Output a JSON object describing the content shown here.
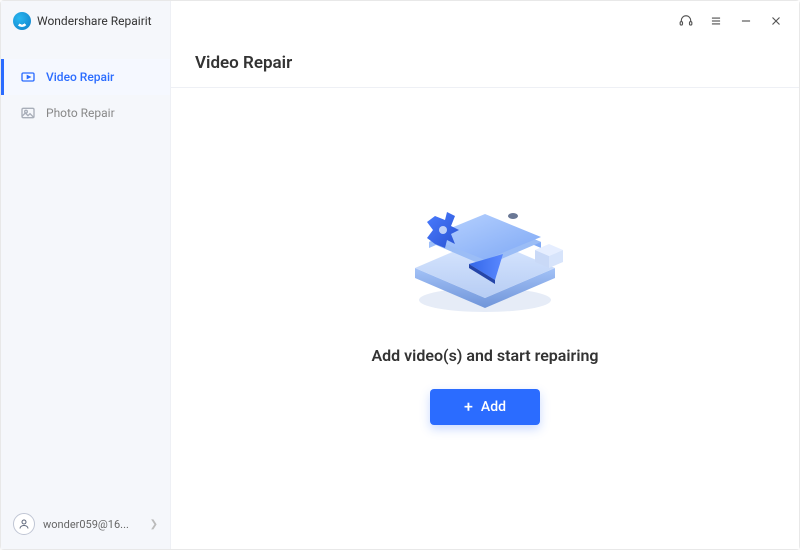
{
  "app": {
    "name": "Wondershare Repairit"
  },
  "sidebar": {
    "items": [
      {
        "label": "Video Repair",
        "active": true
      },
      {
        "label": "Photo Repair",
        "active": false
      }
    ],
    "account": {
      "name": "wonder059@16..."
    }
  },
  "header": {
    "title": "Video Repair"
  },
  "main": {
    "description": "Add video(s) and start repairing",
    "add_button": "Add"
  },
  "colors": {
    "accent": "#2b6cff"
  }
}
